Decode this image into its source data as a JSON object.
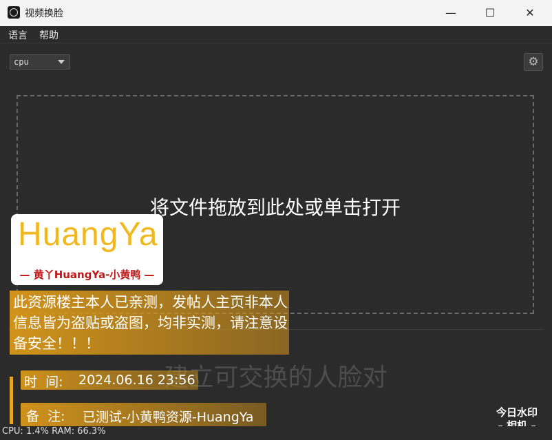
{
  "window": {
    "title": "视频换脸",
    "minimize": "—",
    "maximize": "☐",
    "close": "✕"
  },
  "menu": [
    {
      "label": "语言"
    },
    {
      "label": "帮助"
    }
  ],
  "device": {
    "selected": "cpu"
  },
  "settings": {
    "icon": "gear-icon",
    "glyph": "⚙"
  },
  "drop_zone": {
    "text": "将文件拖放到此处或单击打开"
  },
  "faceswap": {
    "text": "建立可交换的人脸对"
  },
  "watermark": {
    "logo_text": "HuangYa",
    "logo_subtitle": "— 黄丫HuangYa-小黄鸭 —",
    "notice": "此资源楼主本人已亲测，发帖人主页非本人信息皆为盗贴或盗图，均非实测，请注意设备安全！！！",
    "time_label": "时  间:",
    "time_value": "2024.06.16 23:56",
    "note_label": "备  注:",
    "note_value": "已测试-小黄鸭资源-HuangYa",
    "camera_line1": "今日水印",
    "camera_line2": "– 相机 –"
  },
  "status": {
    "text": "CPU: 1.4%  RAM: 66.3%"
  },
  "colors": {
    "background": "#2b2b2b",
    "accent": "#e7a322",
    "titlebar": "#f3f3f3"
  }
}
